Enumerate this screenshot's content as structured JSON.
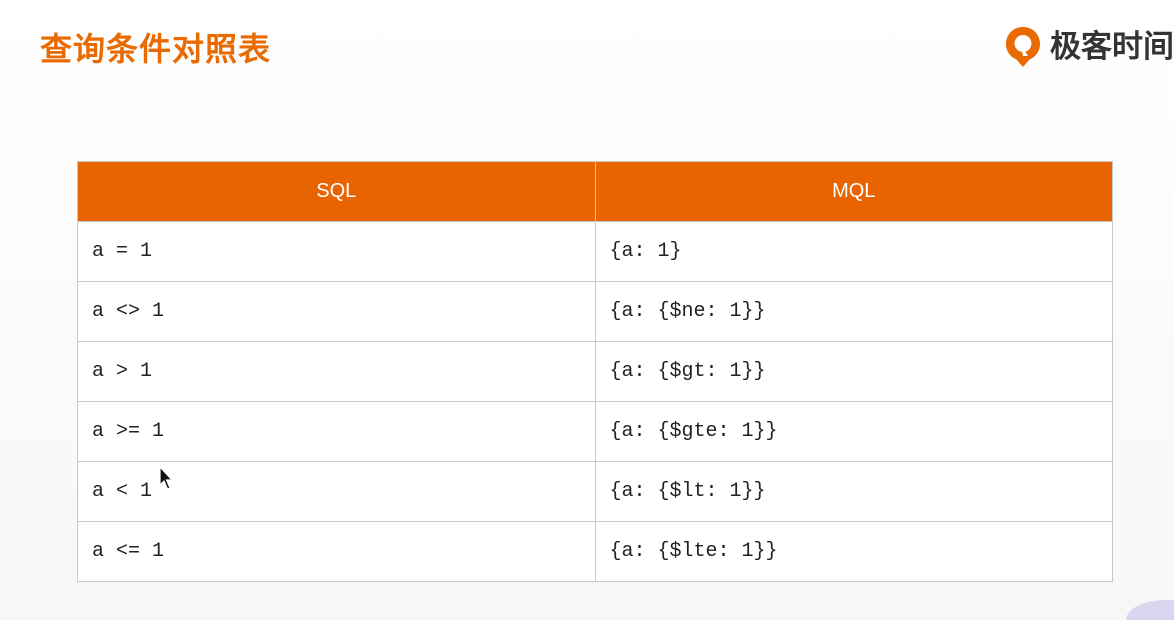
{
  "title": "查询条件对照表",
  "brand": {
    "name": "极客时间",
    "color": "#e86a00",
    "logo_icon": "geektime-logo-icon"
  },
  "table": {
    "headers": [
      "SQL",
      "MQL"
    ],
    "header_color": "#e86400",
    "rows": [
      [
        "a = 1",
        "{a: 1}"
      ],
      [
        "a <> 1",
        "{a: {$ne: 1}}"
      ],
      [
        "a > 1",
        "{a: {$gt: 1}}"
      ],
      [
        "a >= 1",
        "{a: {$gte: 1}}"
      ],
      [
        "a < 1",
        "{a: {$lt: 1}}"
      ],
      [
        "a <= 1",
        "{a: {$lte: 1}}"
      ]
    ]
  },
  "pointer_icon": "mouse-pointer-icon"
}
